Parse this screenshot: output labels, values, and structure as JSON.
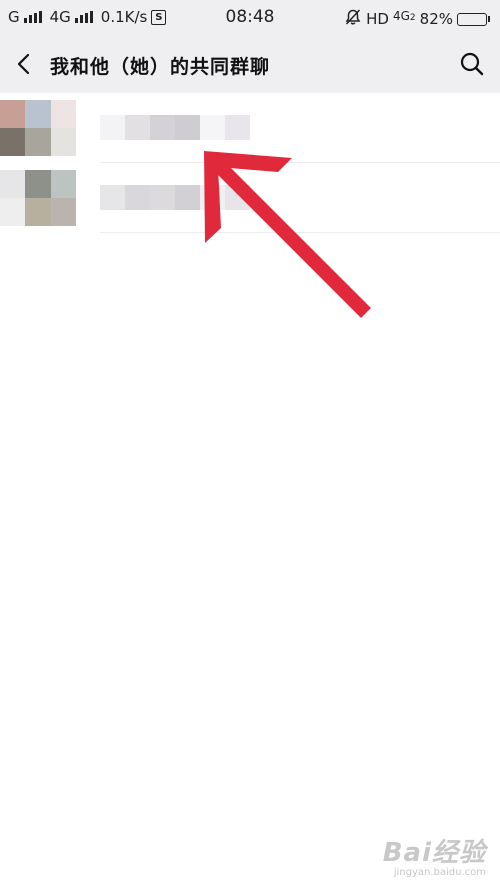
{
  "status_bar": {
    "carrier1": "G",
    "carrier2": "4G",
    "speed": "0.1K/s",
    "s_badge": "S",
    "time": "08:48",
    "hd": "HD",
    "net": "4G",
    "net_sub": "2",
    "battery": "82%",
    "battery_level": 0.82
  },
  "nav": {
    "title": "我和他（她）的共同群聊",
    "back_icon": "chevron-left-icon",
    "search_icon": "search-icon"
  },
  "groups": [
    {
      "avatar_colors": [
        "#c89f95",
        "#b9c3d0",
        "#efe4e4",
        "#7a7268",
        "#a8a69c",
        "#e5e3e0"
      ],
      "name_colors": [
        "#f3f2f4",
        "#e2e0e3",
        "#d4d2d6",
        "#cfcdd1",
        "#f5f4f6",
        "#e8e6ea"
      ]
    },
    {
      "avatar_colors": [
        "#e6e6e8",
        "#8d918a",
        "#bcc3c1",
        "#efeeee",
        "#b8b09e",
        "#bbb3ae"
      ],
      "name_colors": [
        "#e6e5e8",
        "#d9d7db",
        "#dcdadd",
        "#d2d0d4",
        "#f1f0f2",
        "#e7e5e9"
      ]
    }
  ],
  "annotation": {
    "arrow_color": "#e02a3c",
    "arrow_icon": "arrow-up-left-icon"
  },
  "watermark": {
    "brand": "Bai经验",
    "url": "jingyan.baidu.com"
  }
}
